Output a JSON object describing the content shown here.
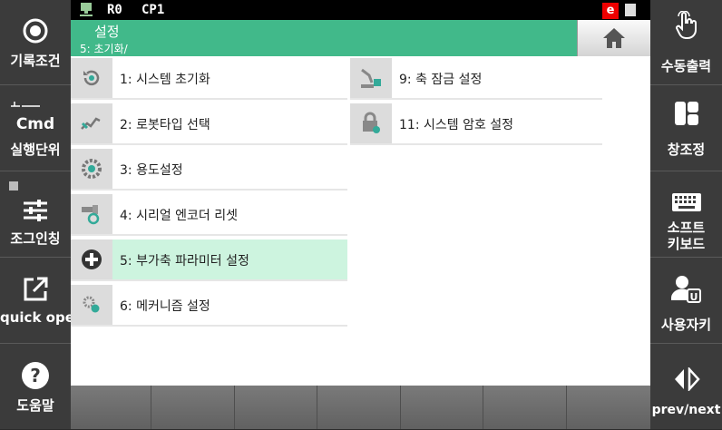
{
  "status_bar": {
    "robot": "R0",
    "program": "CP1",
    "error_badge": "e"
  },
  "header": {
    "title": "설정",
    "breadcrumb": "5: 초기화/"
  },
  "left_panel": [
    {
      "label": "기록조건",
      "icon": "record-circle-icon"
    },
    {
      "label": "실행단위",
      "sub_label": "Cmd",
      "icon": "step-line-icon"
    },
    {
      "label": "조그인칭",
      "icon": "sliders-icon"
    },
    {
      "label": "quick open",
      "icon": "external-open-icon"
    },
    {
      "label": "도움말",
      "icon": "help-icon"
    }
  ],
  "right_panel": [
    {
      "label": "수동출력",
      "icon": "hand-pointer-icon"
    },
    {
      "label": "창조정",
      "icon": "window-layout-icon"
    },
    {
      "label_line1": "소프트",
      "label_line2": "키보드",
      "icon": "keyboard-icon"
    },
    {
      "label": "사용자키",
      "icon": "user-key-icon"
    },
    {
      "label": "prev/next",
      "icon": "prev-next-icon"
    }
  ],
  "menu_left": [
    {
      "label": "1: 시스템 초기화",
      "icon": "system-reset-icon"
    },
    {
      "label": "2: 로봇타입 선택",
      "icon": "robot-type-icon"
    },
    {
      "label": "3: 용도설정",
      "icon": "usage-gear-icon"
    },
    {
      "label": "4: 시리얼 엔코더 리셋",
      "icon": "encoder-reset-icon"
    },
    {
      "label": "5: 부가축 파라미터 설정",
      "icon": "add-axis-icon",
      "selected": true
    },
    {
      "label": "6: 메커니즘 설정",
      "icon": "mechanism-gears-icon"
    }
  ],
  "menu_right": [
    {
      "label": "9: 축 잠금 설정",
      "icon": "axis-lock-icon"
    },
    {
      "label": "11: 시스템 암호 설정",
      "icon": "password-lock-icon"
    }
  ],
  "colors": {
    "accent": "#41b98a",
    "selected": "#cdf4df",
    "panel": "#3b3b3b"
  }
}
